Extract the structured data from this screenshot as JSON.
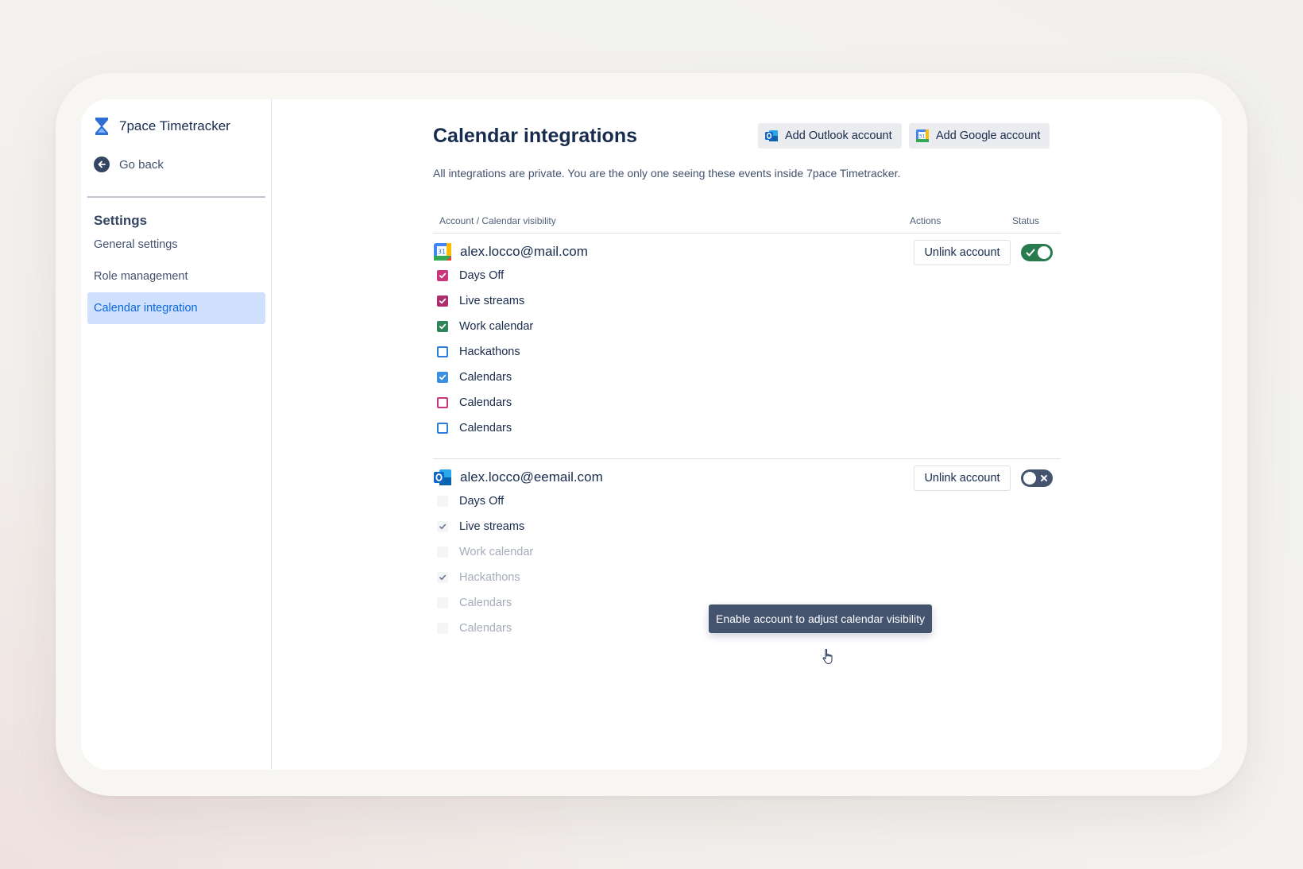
{
  "app": {
    "name": "7pace Timetracker"
  },
  "sidebar": {
    "go_back": "Go back",
    "section_title": "Settings",
    "items": [
      {
        "label": "General settings",
        "active": false
      },
      {
        "label": "Role management",
        "active": false
      },
      {
        "label": "Calendar integration",
        "active": true
      }
    ]
  },
  "main": {
    "title": "Calendar integrations",
    "add_outlook": "Add Outlook account",
    "add_google": "Add Google account",
    "subtitle": "All integrations are private. You are the only one seeing these events inside 7pace Timetracker.",
    "columns": {
      "account": "Account / Calendar visibility",
      "actions": "Actions",
      "status": "Status"
    },
    "accounts": [
      {
        "email": "alex.locco@mail.com",
        "provider_icon": "google-calendar-icon",
        "unlink": "Unlink account",
        "enabled": true,
        "calendars": [
          {
            "name": "Days Off",
            "checked": true,
            "color": "#c9377a"
          },
          {
            "name": "Live streams",
            "checked": true,
            "color": "#ae2e6b"
          },
          {
            "name": "Work calendar",
            "checked": true,
            "color": "#2f855a"
          },
          {
            "name": "Hackathons",
            "checked": false,
            "color": "#2d7fdc"
          },
          {
            "name": "Calendars",
            "checked": true,
            "color": "#3b8fe0"
          },
          {
            "name": "Calendars",
            "checked": false,
            "color": "#c9377a"
          },
          {
            "name": "Calendars",
            "checked": false,
            "color": "#2d7fdc"
          }
        ]
      },
      {
        "email": "alex.locco@eemail.com",
        "provider_icon": "outlook-icon",
        "unlink": "Unlink account",
        "enabled": false,
        "calendars": [
          {
            "name": "Days Off",
            "checked": false
          },
          {
            "name": "Live streams",
            "checked": true
          },
          {
            "name": "Work calendar",
            "checked": false
          },
          {
            "name": "Hackathons",
            "checked": true
          },
          {
            "name": "Calendars",
            "checked": false
          },
          {
            "name": "Calendars",
            "checked": false
          }
        ]
      }
    ],
    "tooltip": "Enable account to adjust calendar visibility"
  },
  "colors": {
    "accent": "#0c66e4",
    "active_nav_bg": "#cfe1fd",
    "toggle_on": "#2a7a4f",
    "toggle_off": "#44546f",
    "tooltip_bg": "#44546f"
  }
}
